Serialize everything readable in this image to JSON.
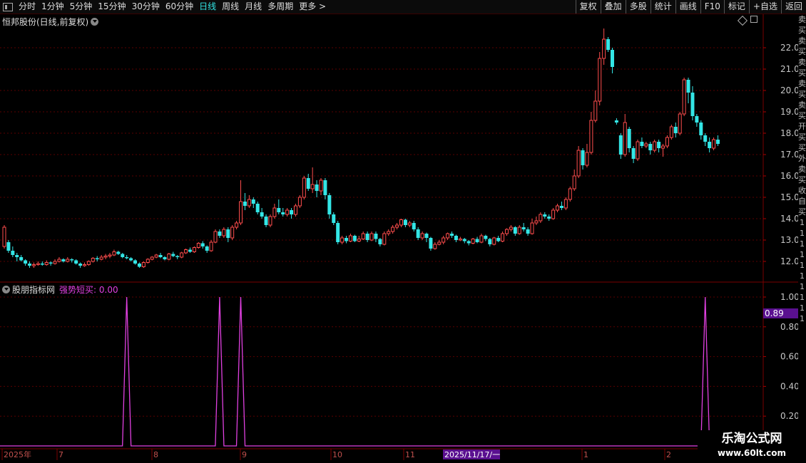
{
  "toolbar": {
    "periods": [
      "分时",
      "1分钟",
      "5分钟",
      "15分钟",
      "30分钟",
      "60分钟",
      "日线",
      "周线",
      "月线",
      "多周期",
      "更多 >"
    ],
    "active_period": "日线",
    "right_buttons": [
      "复权",
      "叠加",
      "多股",
      "统计",
      "画线",
      "F10",
      "标记",
      "+自选",
      "返回"
    ]
  },
  "main_pane": {
    "title": "恒邦股份(日线,前复权)",
    "price_ticks": [
      "22.00",
      "21.00",
      "20.00",
      "19.00",
      "18.00",
      "17.00",
      "16.00",
      "15.00",
      "14.00",
      "13.00",
      "12.00"
    ]
  },
  "indicator_pane": {
    "name": "股朋指标网",
    "line_label": "强势短买: 0.00",
    "ticks": [
      "1.00",
      "0.80",
      "0.60",
      "0.40",
      "0.20"
    ],
    "current_value": "0.89"
  },
  "date_axis": {
    "labels": [
      "2025年",
      "7",
      "8",
      "9",
      "10",
      "11",
      "1",
      "2"
    ],
    "cursor_date": "2025/11/17/一"
  },
  "watermark": {
    "title": "乐淘公式网",
    "url": "www.60lt.com"
  },
  "side_strip": {
    "chars": [
      "卖",
      "买",
      "卖",
      "买",
      "卖",
      "买",
      "卖",
      "买",
      "卖",
      "买",
      "开",
      "买",
      "买",
      "外",
      "卖",
      "买",
      "收",
      "自",
      "买",
      "1",
      "1",
      "1",
      "1",
      "1",
      "1",
      "1",
      "1",
      "1",
      "1"
    ]
  },
  "colors": {
    "up": "#ff4d4d",
    "down": "#33e6e6",
    "grid": "#5a0000",
    "axis_text": "#c8c8c8",
    "signal": "#e040e0",
    "active_period": "#33e6e6"
  },
  "chart_data": [
    {
      "type": "candlestick",
      "ylim": [
        11.3,
        22.9
      ],
      "candles": [
        [
          12.7,
          13.6,
          13.7,
          12.6
        ],
        [
          12.9,
          12.5,
          13.0,
          12.4
        ],
        [
          12.5,
          12.3,
          12.7,
          12.2
        ],
        [
          12.3,
          12.2,
          12.4,
          12.0
        ],
        [
          12.2,
          12.05,
          12.3,
          12.0
        ],
        [
          12.05,
          11.9,
          12.1,
          11.8
        ],
        [
          11.9,
          11.8,
          12.0,
          11.7
        ],
        [
          11.8,
          11.85,
          11.95,
          11.7
        ],
        [
          11.85,
          11.9,
          12.0,
          11.8
        ],
        [
          11.9,
          11.85,
          12.0,
          11.8
        ],
        [
          11.85,
          11.95,
          12.05,
          11.8
        ],
        [
          11.95,
          11.9,
          12.0,
          11.8
        ],
        [
          11.9,
          12.0,
          12.1,
          11.85
        ],
        [
          12.0,
          12.1,
          12.2,
          11.95
        ],
        [
          12.1,
          12.0,
          12.15,
          11.95
        ],
        [
          12.0,
          12.1,
          12.2,
          11.95
        ],
        [
          12.1,
          12.05,
          12.15,
          11.95
        ],
        [
          12.05,
          11.9,
          12.1,
          11.85
        ],
        [
          11.9,
          11.8,
          11.95,
          11.7
        ],
        [
          11.8,
          11.85,
          11.95,
          11.75
        ],
        [
          11.85,
          12.0,
          12.05,
          11.8
        ],
        [
          12.0,
          12.15,
          12.2,
          11.95
        ],
        [
          12.15,
          12.1,
          12.25,
          12.0
        ],
        [
          12.1,
          12.2,
          12.3,
          12.05
        ],
        [
          12.2,
          12.25,
          12.35,
          12.1
        ],
        [
          12.25,
          12.3,
          12.4,
          12.15
        ],
        [
          12.3,
          12.45,
          12.55,
          12.25
        ],
        [
          12.45,
          12.35,
          12.5,
          12.3
        ],
        [
          12.35,
          12.2,
          12.4,
          12.15
        ],
        [
          12.2,
          12.15,
          12.3,
          12.1
        ],
        [
          12.15,
          12.05,
          12.2,
          12.0
        ],
        [
          12.05,
          11.9,
          12.1,
          11.85
        ],
        [
          11.9,
          11.75,
          11.95,
          11.7
        ],
        [
          11.75,
          11.95,
          12.0,
          11.7
        ],
        [
          11.95,
          12.1,
          12.15,
          11.9
        ],
        [
          12.1,
          12.2,
          12.25,
          12.05
        ],
        [
          12.2,
          12.3,
          12.35,
          12.15
        ],
        [
          12.3,
          12.2,
          12.4,
          12.15
        ],
        [
          12.2,
          12.1,
          12.25,
          12.05
        ],
        [
          12.1,
          12.35,
          12.4,
          12.05
        ],
        [
          12.35,
          12.25,
          12.45,
          12.2
        ],
        [
          12.25,
          12.2,
          12.3,
          12.1
        ],
        [
          12.2,
          12.4,
          12.45,
          12.15
        ],
        [
          12.4,
          12.55,
          12.6,
          12.35
        ],
        [
          12.55,
          12.45,
          12.65,
          12.4
        ],
        [
          12.45,
          12.65,
          12.7,
          12.4
        ],
        [
          12.65,
          12.85,
          12.9,
          12.6
        ],
        [
          12.85,
          12.7,
          12.95,
          12.6
        ],
        [
          12.7,
          12.5,
          12.75,
          12.4
        ],
        [
          12.5,
          12.9,
          13.0,
          12.45
        ],
        [
          12.9,
          13.4,
          13.5,
          12.85
        ],
        [
          13.4,
          13.2,
          13.5,
          13.1
        ],
        [
          13.2,
          13.5,
          13.6,
          13.1
        ],
        [
          13.5,
          13.1,
          13.6,
          12.9
        ],
        [
          13.1,
          13.6,
          13.7,
          13.0
        ],
        [
          13.6,
          13.8,
          13.9,
          13.5
        ],
        [
          13.8,
          14.8,
          15.8,
          13.7
        ],
        [
          14.8,
          14.6,
          15.2,
          14.4
        ],
        [
          14.6,
          14.9,
          15.1,
          14.5
        ],
        [
          14.9,
          14.7,
          15.0,
          14.5
        ],
        [
          14.7,
          14.3,
          14.8,
          14.2
        ],
        [
          14.3,
          14.1,
          14.5,
          14.0
        ],
        [
          14.1,
          13.7,
          14.2,
          13.6
        ],
        [
          13.7,
          14.1,
          14.2,
          13.6
        ],
        [
          14.1,
          14.5,
          14.7,
          14.0
        ],
        [
          14.5,
          14.3,
          14.9,
          14.2
        ],
        [
          14.3,
          14.2,
          14.5,
          14.1
        ],
        [
          14.2,
          14.4,
          14.5,
          14.1
        ],
        [
          14.4,
          14.2,
          14.5,
          14.0
        ],
        [
          14.2,
          14.6,
          14.7,
          14.1
        ],
        [
          14.6,
          15.0,
          15.1,
          14.5
        ],
        [
          15.0,
          15.9,
          16.0,
          14.9
        ],
        [
          15.9,
          15.4,
          16.1,
          15.3
        ],
        [
          15.4,
          15.6,
          16.4,
          15.2
        ],
        [
          15.6,
          15.3,
          15.8,
          15.0
        ],
        [
          15.3,
          15.8,
          15.9,
          15.1
        ],
        [
          15.8,
          15.1,
          15.9,
          14.9
        ],
        [
          15.1,
          14.2,
          15.2,
          14.0
        ],
        [
          14.2,
          13.8,
          14.3,
          13.7
        ],
        [
          13.8,
          12.9,
          13.9,
          12.8
        ],
        [
          12.9,
          13.1,
          13.2,
          12.8
        ],
        [
          13.1,
          12.95,
          13.2,
          12.85
        ],
        [
          12.95,
          13.2,
          13.3,
          12.9
        ],
        [
          13.2,
          12.95,
          13.25,
          12.9
        ],
        [
          12.95,
          13.05,
          13.2,
          12.9
        ],
        [
          13.05,
          13.3,
          13.4,
          13.0
        ],
        [
          13.3,
          13.0,
          13.4,
          12.9
        ],
        [
          13.0,
          13.3,
          13.4,
          12.95
        ],
        [
          13.3,
          13.05,
          13.4,
          12.9
        ],
        [
          13.05,
          12.8,
          13.1,
          12.7
        ],
        [
          12.8,
          13.3,
          13.4,
          12.75
        ],
        [
          13.3,
          13.4,
          13.5,
          13.2
        ],
        [
          13.4,
          13.6,
          13.7,
          13.3
        ],
        [
          13.6,
          13.7,
          13.8,
          13.5
        ],
        [
          13.7,
          13.95,
          14.0,
          13.6
        ],
        [
          13.95,
          13.7,
          14.0,
          13.6
        ],
        [
          13.7,
          13.8,
          13.9,
          13.6
        ],
        [
          13.8,
          13.5,
          13.9,
          13.4
        ],
        [
          13.5,
          13.1,
          13.6,
          13.0
        ],
        [
          13.1,
          13.3,
          13.4,
          13.0
        ],
        [
          13.3,
          13.1,
          13.35,
          12.9
        ],
        [
          13.1,
          12.6,
          13.15,
          12.5
        ],
        [
          12.6,
          12.8,
          12.9,
          12.55
        ],
        [
          12.8,
          12.9,
          13.0,
          12.75
        ],
        [
          12.9,
          13.1,
          13.2,
          12.8
        ],
        [
          13.1,
          13.3,
          13.35,
          13.0
        ],
        [
          13.3,
          13.2,
          13.4,
          13.1
        ],
        [
          13.2,
          13.0,
          13.25,
          12.9
        ],
        [
          13.0,
          13.05,
          13.15,
          12.95
        ],
        [
          13.05,
          12.95,
          13.1,
          12.85
        ],
        [
          12.95,
          12.85,
          13.0,
          12.75
        ],
        [
          12.85,
          13.05,
          13.1,
          12.8
        ],
        [
          13.05,
          12.9,
          13.15,
          12.85
        ],
        [
          12.9,
          13.2,
          13.3,
          12.85
        ],
        [
          13.2,
          13.05,
          13.25,
          12.95
        ],
        [
          13.05,
          12.8,
          13.1,
          12.7
        ],
        [
          12.8,
          13.1,
          13.15,
          12.75
        ],
        [
          13.1,
          12.95,
          13.2,
          12.9
        ],
        [
          12.95,
          13.3,
          13.4,
          12.9
        ],
        [
          13.3,
          13.5,
          13.55,
          13.2
        ],
        [
          13.5,
          13.6,
          13.7,
          13.4
        ],
        [
          13.6,
          13.3,
          13.65,
          13.2
        ],
        [
          13.3,
          13.6,
          13.7,
          13.25
        ],
        [
          13.6,
          13.5,
          13.8,
          13.4
        ],
        [
          13.5,
          13.3,
          13.6,
          13.2
        ],
        [
          13.3,
          13.8,
          14.0,
          13.25
        ],
        [
          13.8,
          13.9,
          14.1,
          13.7
        ],
        [
          13.9,
          14.2,
          14.3,
          13.8
        ],
        [
          14.2,
          14.1,
          14.3,
          14.0
        ],
        [
          14.1,
          14.0,
          14.2,
          13.9
        ],
        [
          14.0,
          14.4,
          14.5,
          13.95
        ],
        [
          14.4,
          14.6,
          14.7,
          14.3
        ],
        [
          14.6,
          14.5,
          14.8,
          14.4
        ],
        [
          14.5,
          14.9,
          15.0,
          14.4
        ],
        [
          14.9,
          15.4,
          15.5,
          14.8
        ],
        [
          15.4,
          16.0,
          16.3,
          15.3
        ],
        [
          16.0,
          17.2,
          17.4,
          15.9
        ],
        [
          17.2,
          16.5,
          17.3,
          16.3
        ],
        [
          16.5,
          17.1,
          17.5,
          16.4
        ],
        [
          17.1,
          18.6,
          19.0,
          17.0
        ],
        [
          18.6,
          19.5,
          20.0,
          18.5
        ],
        [
          19.5,
          21.5,
          21.8,
          19.3
        ],
        [
          21.5,
          22.4,
          22.9,
          21.2
        ],
        [
          22.4,
          21.9,
          22.5,
          21.8
        ],
        [
          21.9,
          21.1,
          22.0,
          20.8
        ],
        [
          18.6,
          18.5,
          18.7,
          18.4
        ],
        [
          17.9,
          17.0,
          18.0,
          16.8
        ],
        [
          17.0,
          18.5,
          18.9,
          16.9
        ],
        [
          18.2,
          17.3,
          18.3,
          17.1
        ],
        [
          17.3,
          16.8,
          17.4,
          16.6
        ],
        [
          16.8,
          17.6,
          17.7,
          16.7
        ],
        [
          17.6,
          17.4,
          17.8,
          17.3
        ],
        [
          17.4,
          17.5,
          17.6,
          17.3
        ],
        [
          17.5,
          17.2,
          17.6,
          17.0
        ],
        [
          17.2,
          17.6,
          17.7,
          17.1
        ],
        [
          17.6,
          17.3,
          17.7,
          17.1
        ],
        [
          17.3,
          17.4,
          17.5,
          16.9
        ],
        [
          17.4,
          17.8,
          17.9,
          17.3
        ],
        [
          17.8,
          18.3,
          18.4,
          17.7
        ],
        [
          18.3,
          18.0,
          18.5,
          17.8
        ],
        [
          18.0,
          18.9,
          19.0,
          17.9
        ],
        [
          18.9,
          20.5,
          20.6,
          18.8
        ],
        [
          20.5,
          19.9,
          20.6,
          19.4
        ],
        [
          19.9,
          18.8,
          20.2,
          18.6
        ],
        [
          18.8,
          18.5,
          18.9,
          18.3
        ],
        [
          18.5,
          17.9,
          18.6,
          17.7
        ],
        [
          17.9,
          17.6,
          18.0,
          17.4
        ],
        [
          17.6,
          17.3,
          17.8,
          17.1
        ],
        [
          17.3,
          17.7,
          17.8,
          17.2
        ],
        [
          17.7,
          17.5,
          17.9,
          17.4
        ]
      ]
    },
    {
      "type": "line",
      "name": "强势短买",
      "ylim": [
        0,
        1.0
      ],
      "spikes_at_candle_index": [
        29,
        51,
        56,
        166
      ],
      "baseline_value": 0
    }
  ]
}
